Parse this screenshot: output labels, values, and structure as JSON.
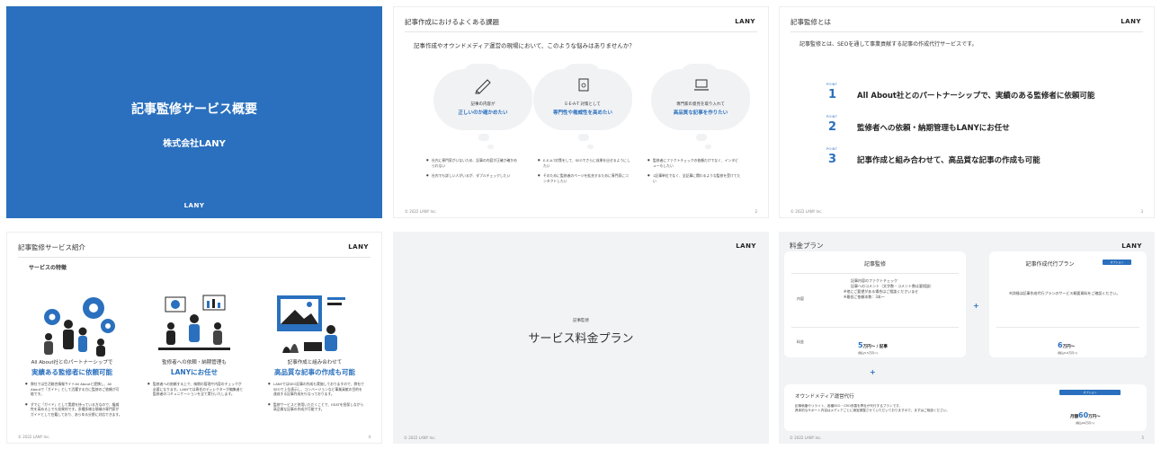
{
  "brand": "LANY",
  "copyright": "© 2022 LANY Inc.",
  "slide1": {
    "title": "記事監修サービス概要",
    "company": "株式会社LANY",
    "logo": "LANY"
  },
  "slide2": {
    "title": "記事作成におけるよくある課題",
    "lead": "記事作成やオウンドメディア運営の現場において、このような悩みはありませんか？",
    "clouds": [
      {
        "icon": "pencil-icon",
        "line1": "記事の内容が",
        "line2": "正しいのか確かめたい",
        "bullets": [
          "社内に専門家がいないため、記事の内容が正確か確かめられない",
          "社内でも詳しい人がいるが、ダブルチェックしたい"
        ]
      },
      {
        "icon": "document-icon",
        "line1": "E-E-A-T 対策として",
        "line2": "専門性や権威性を高めたい",
        "bullets": [
          "E-E-A-T対策をして、SEOでさらに成果を出せるようにしたい",
          "そのために監修者のページを拡充するために専門家にコンタクトしたい"
        ]
      },
      {
        "icon": "laptop-icon",
        "line1": "専門家の意見を取り入れて",
        "line2": "高品質な記事を作りたい",
        "bullets": [
          "監修者にファクトチェックの依頼だけでなく、インタビューもしたい",
          "1記事単位でなく、全記事に関わるような監修を受けてたい"
        ]
      }
    ],
    "page": "2"
  },
  "slide3": {
    "title": "記事監修とは",
    "lead": "記事監修とは、SEOを通して事業貢献する記事の作成代行サービスです。",
    "point_label": "POINT",
    "points": [
      {
        "num": "1",
        "text": "All About社とのパートナーシップで、実績のある監修者に依頼可能"
      },
      {
        "num": "2",
        "text": "監修者への依頼・納期管理もLANYにお任せ"
      },
      {
        "num": "3",
        "text": "記事作成と組み合わせて、高品質な記事の作成も可能"
      }
    ],
    "page": "3"
  },
  "slide4": {
    "title": "記事監修サービス紹介",
    "section": "サービスの特徴",
    "cols": [
      {
        "line1": "All About社とのパートナーシップで",
        "line2": "実績ある監修者に依頼可能",
        "bullets": [
          "弊社では生活総合情報サイトAll Aboutと提携し、All Aboutで「ガイド」として活躍する方に監修のご依頼が可能です。",
          "ずでに「ガイド」として実績を持っている方なので、権威性を高める上でも効果的です。多種多様な領域の専門家がガイドとして在籍しており、あらゆる分野に対応できます。"
        ]
      },
      {
        "line1": "監修者への依頼・納期管理も",
        "line2": "LANYにお任せ",
        "bullets": [
          "監修者への依頼する上で、納期の管理や内容のチェックが必要になります。LANYでは専任のディレクターが編集者と監修者のコミュニケーションを全て実行いたします。"
        ]
      },
      {
        "line1": "記事作成と組み合わせて",
        "line2": "高品質な記事の作成も可能",
        "bullets": [
          "LANYではSEO記事の作成も実施しておりますので、弊社でSEOで上位表示し、コンバージョンなど事業貢献の目的を達成する記事作成を行なっております。",
          "監修サービスと併用いただくことで、EEATを担保しながら高品質な記事の作成が可能です。"
        ]
      }
    ],
    "page": "4"
  },
  "slide5": {
    "kicker": "記事監修",
    "title": "サービス料金プラン"
  },
  "slide6": {
    "title": "料金プラン",
    "card1": {
      "heading": "記事監修",
      "row1_label": "内容",
      "items": [
        "記事内容のファクトチェック",
        "記事へのコメント（文字数・コメント数は要相談）"
      ],
      "notes": [
        "※他にご要望がある場合はご相談くださいませ",
        "※最低ご依頼本数：3本〜"
      ],
      "row2_label": "料金",
      "price_big": "5",
      "price_unit": "万円〜 / 記事",
      "price_tax": "(税込5.5万円〜)"
    },
    "card2": {
      "heading": "記事作成代行プラン",
      "tag": "オプション",
      "note": "※詳細は記事作成代行プランのサービス概要資料をご確認ください。",
      "price_big": "6",
      "price_unit": "万円〜",
      "price_tax": "(税込6.6万円〜)"
    },
    "card3": {
      "heading": "オウンドメディア運営代行",
      "tag": "オプション",
      "desc1": "記事執筆やリライト、各種SEO・CRO改善を弊社が代行するプランです。",
      "desc2": "具体的なサポート内容はメディアごとに適宜調整させていただいておりますので、まずはご相談ください。",
      "price_prefix": "月額",
      "price_big": "60",
      "price_unit": "万円〜",
      "price_tax": "(税込66万円〜)"
    },
    "plus": "+",
    "page": "5"
  },
  "colors": {
    "accent": "#2a70be",
    "panel": "#f2f3f5",
    "cloud": "#f1f2f4"
  }
}
